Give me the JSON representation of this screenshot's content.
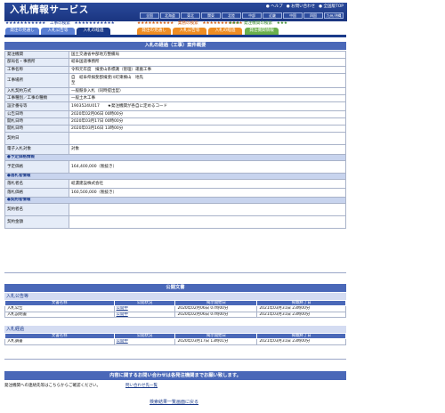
{
  "header": {
    "title": "入札情報サービス",
    "links": [
      "● ヘルプ",
      "● お問い合わせ",
      "● 全国版TOP"
    ],
    "areas": [
      "全国",
      "北海道",
      "東北",
      "関東",
      "北陸",
      "中部",
      "近畿",
      "中国",
      "四国",
      "九州/沖縄"
    ]
  },
  "sections": {
    "construction": "★★★★★★★★★★★　工事の検索　★★★★★★★★★★★",
    "service": "★★★★★★★★★★　業務の検索　★★★★★★★★★★★",
    "orderer": "★★★　発注機関の検索　★★★"
  },
  "tabs": [
    "発注の見通し",
    "入札公告等",
    "入札の経過",
    "発注の見通し",
    "入札公告等",
    "入札の経過",
    "発注機関情報"
  ],
  "detail": {
    "title": "入札の経過（工事）案件概要",
    "rows": [
      {
        "k": "発注機関",
        "v": "国土交通省中部地方整備局"
      },
      {
        "k": "部局名・事務所",
        "v": "岐阜国道事務所"
      },
      {
        "k": "工事名称",
        "v": "令和元年度　揖斐山系標識（管理）運搬工事"
      },
      {
        "k": "工事場所",
        "v": "自　岐阜県揖斐郡揖斐川町東横山　地先",
        "v2": "至"
      },
      {
        "k": "入札契約方式",
        "v": "一般競争入札（同時提出型）"
      },
      {
        "k": "工事種別／工事の種類",
        "v": "一般土木工事"
      },
      {
        "k": "設計番号等",
        "v": "1903524U017　　★発注機関が各自に定めるコード"
      },
      {
        "k": "公告日時",
        "v": "2020年02月06日 00時00分"
      },
      {
        "k": "開札日時",
        "v": "2020年03月17日 00時00分"
      },
      {
        "k": "開札日時",
        "v": "2020年03月16日 13時00分"
      },
      {
        "k": "契約日",
        "v": ""
      },
      {
        "k": "電子入札対象",
        "v": "対象"
      },
      {
        "group": "●予定価格情報"
      },
      {
        "k": "予定価格",
        "v": "164,400,000（税抜き）"
      },
      {
        "group": "●落札者情報"
      },
      {
        "k": "落札者名",
        "v": "岐濃建設株式会社"
      },
      {
        "k": "落札価格",
        "v": "160,500,000（税抜き）"
      },
      {
        "group": "●契約者情報"
      },
      {
        "k": "契約者名",
        "v": ""
      },
      {
        "k": "契約金額",
        "v": ""
      }
    ]
  },
  "docs": {
    "title": "公開文書",
    "cols": [
      "文書名称",
      "公開状況",
      "掲示開始日",
      "掲載終了日"
    ],
    "announce": {
      "label": "入札公告等",
      "rows": [
        [
          "入札公告",
          "公開中",
          "2020年02月06日 07時00分",
          "2021年03月31日 23時00分"
        ],
        [
          "入札説明書",
          "公開中",
          "2020年02月06日 07時00分",
          "2021年03月31日 23時00分"
        ]
      ]
    },
    "result": {
      "label": "入札経過",
      "rows": [
        [
          "入札調書",
          "公開中",
          "2020年03月17日 13時01分",
          "2021年03月31日 23時00分"
        ]
      ]
    }
  },
  "contact": {
    "title": "内容に関するお問い合わせは各発注機関までお願い致します。",
    "text": "発注機関への連絡先等はこちらからご確認ください。",
    "link": "問い合わせ先一覧"
  },
  "back": "検索結果一覧画面に戻る"
}
